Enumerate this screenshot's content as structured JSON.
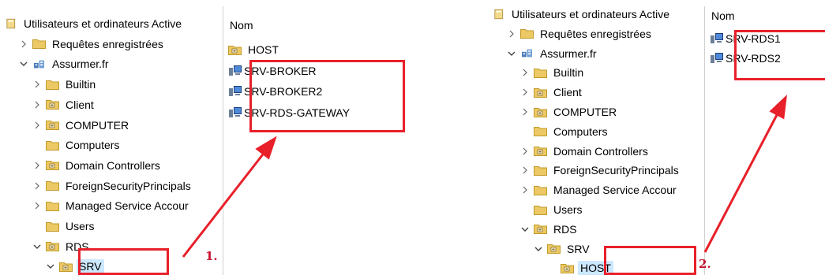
{
  "left": {
    "tree": [
      {
        "label": "Utilisateurs et ordinateurs Active",
        "indent": 0,
        "chevron": "none",
        "icon": "console-icon"
      },
      {
        "label": "Requêtes enregistrées",
        "indent": 1,
        "chevron": "right",
        "icon": "folder-icon"
      },
      {
        "label": "Assurmer.fr",
        "indent": 1,
        "chevron": "down",
        "icon": "domain-icon"
      },
      {
        "label": "Builtin",
        "indent": 2,
        "chevron": "right",
        "icon": "folder-icon"
      },
      {
        "label": "Client",
        "indent": 2,
        "chevron": "right",
        "icon": "ou-folder-icon"
      },
      {
        "label": "COMPUTER",
        "indent": 2,
        "chevron": "right",
        "icon": "ou-folder-icon"
      },
      {
        "label": "Computers",
        "indent": 2,
        "chevron": "none",
        "icon": "folder-icon"
      },
      {
        "label": "Domain Controllers",
        "indent": 2,
        "chevron": "right",
        "icon": "ou-folder-icon"
      },
      {
        "label": "ForeignSecurityPrincipals",
        "indent": 2,
        "chevron": "right",
        "icon": "folder-icon"
      },
      {
        "label": "Managed Service Accour",
        "indent": 2,
        "chevron": "right",
        "icon": "folder-icon"
      },
      {
        "label": "Users",
        "indent": 2,
        "chevron": "none",
        "icon": "folder-icon"
      },
      {
        "label": "RDS",
        "indent": 2,
        "chevron": "down",
        "icon": "ou-folder-icon"
      },
      {
        "label": "SRV",
        "indent": 3,
        "chevron": "down",
        "icon": "ou-folder-icon",
        "selected": true
      }
    ],
    "column_header": "Nom",
    "items": [
      {
        "label": "HOST",
        "icon": "ou-folder-icon"
      },
      {
        "label": "SRV-BROKER",
        "icon": "computer-icon"
      },
      {
        "label": "SRV-BROKER2",
        "icon": "computer-icon"
      },
      {
        "label": "SRV-RDS-GATEWAY",
        "icon": "computer-icon"
      }
    ],
    "step_label": "1."
  },
  "right": {
    "tree": [
      {
        "label": "Utilisateurs et ordinateurs Active",
        "indent": 0,
        "chevron": "none",
        "icon": "console-icon"
      },
      {
        "label": "Requêtes enregistrées",
        "indent": 1,
        "chevron": "right",
        "icon": "folder-icon"
      },
      {
        "label": "Assurmer.fr",
        "indent": 1,
        "chevron": "down",
        "icon": "domain-icon"
      },
      {
        "label": "Builtin",
        "indent": 2,
        "chevron": "right",
        "icon": "folder-icon"
      },
      {
        "label": "Client",
        "indent": 2,
        "chevron": "right",
        "icon": "ou-folder-icon"
      },
      {
        "label": "COMPUTER",
        "indent": 2,
        "chevron": "right",
        "icon": "ou-folder-icon"
      },
      {
        "label": "Computers",
        "indent": 2,
        "chevron": "none",
        "icon": "folder-icon"
      },
      {
        "label": "Domain Controllers",
        "indent": 2,
        "chevron": "right",
        "icon": "ou-folder-icon"
      },
      {
        "label": "ForeignSecurityPrincipals",
        "indent": 2,
        "chevron": "right",
        "icon": "folder-icon"
      },
      {
        "label": "Managed Service Accour",
        "indent": 2,
        "chevron": "right",
        "icon": "folder-icon"
      },
      {
        "label": "Users",
        "indent": 2,
        "chevron": "none",
        "icon": "folder-icon"
      },
      {
        "label": "RDS",
        "indent": 2,
        "chevron": "down",
        "icon": "ou-folder-icon"
      },
      {
        "label": "SRV",
        "indent": 3,
        "chevron": "down",
        "icon": "ou-folder-icon"
      },
      {
        "label": "HOST",
        "indent": 4,
        "chevron": "none",
        "icon": "ou-folder-icon",
        "selected": true
      }
    ],
    "column_header": "Nom",
    "items": [
      {
        "label": "SRV-RDS1",
        "icon": "computer-icon"
      },
      {
        "label": "SRV-RDS2",
        "icon": "computer-icon"
      }
    ],
    "step_label": "2."
  },
  "colors": {
    "highlight": "#e8202a",
    "selection": "#cce8ff",
    "folder": "#e8c867",
    "step_text": "#c8102e"
  }
}
